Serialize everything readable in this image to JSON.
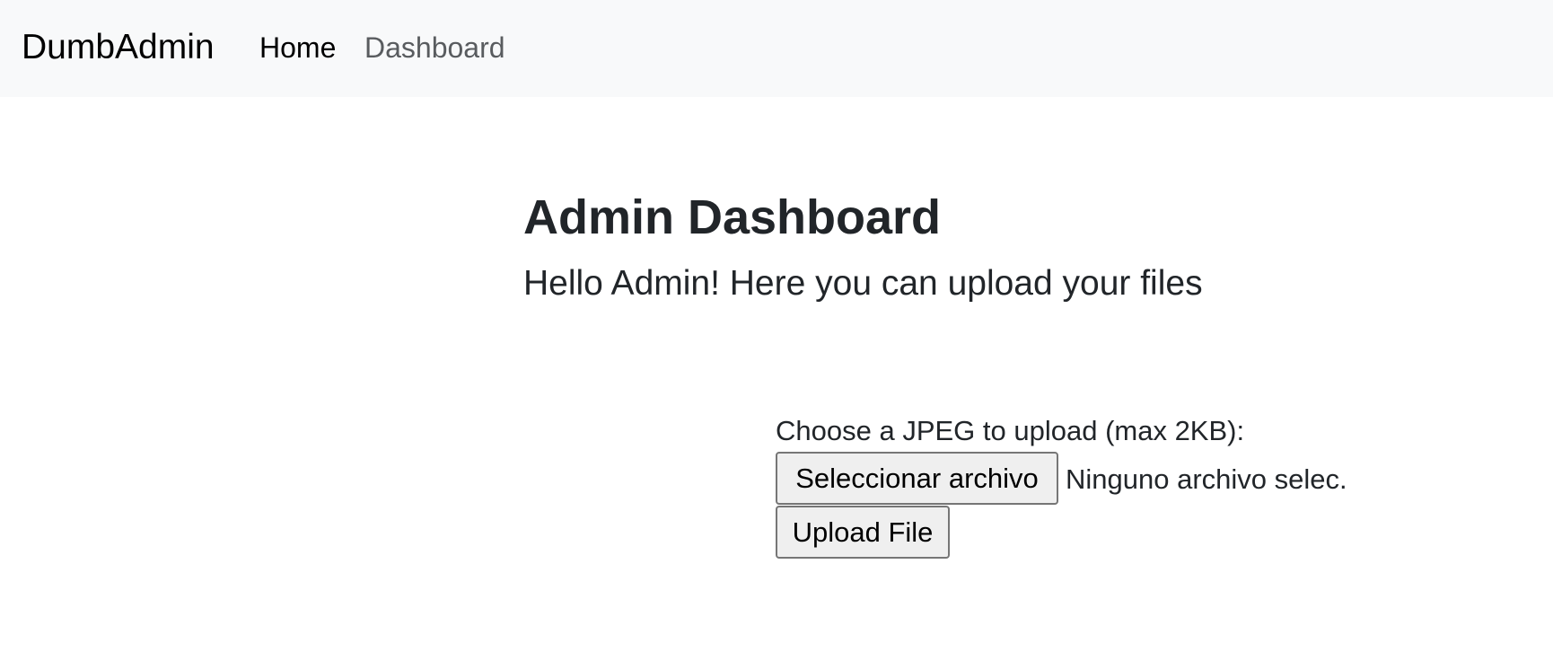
{
  "navbar": {
    "brand": "DumbAdmin",
    "links": [
      {
        "label": "Home"
      },
      {
        "label": "Dashboard"
      }
    ]
  },
  "main": {
    "title": "Admin Dashboard",
    "subtitle": "Hello Admin! Here you can upload your files"
  },
  "upload_form": {
    "label": "Choose a JPEG to upload (max 2KB):",
    "choose_button_label": "Seleccionar archivo",
    "file_status": "Ninguno archivo selec.",
    "submit_label": "Upload File"
  },
  "colors": {
    "navbar_bg": "#f8f9fa",
    "text": "#212529",
    "nav_link_muted": "#595c5f",
    "button_bg": "#efefef",
    "button_border": "#767676"
  }
}
